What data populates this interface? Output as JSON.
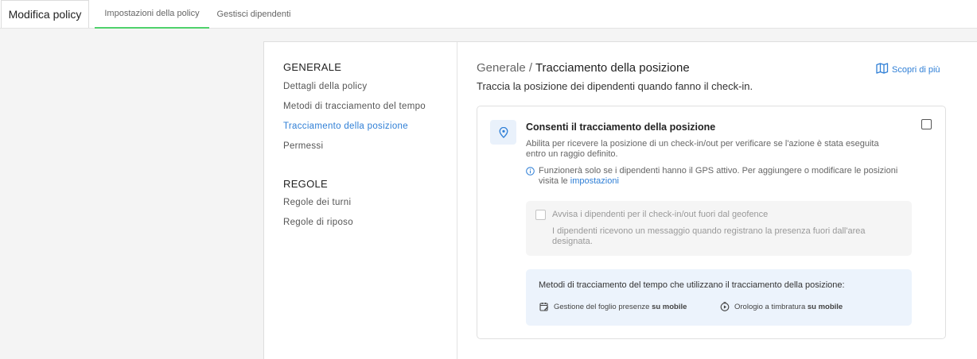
{
  "header": {
    "title": "Modifica policy",
    "tabs": [
      {
        "label": "Impostazioni della policy",
        "active": true
      },
      {
        "label": "Gestisci dipendenti",
        "active": false
      }
    ]
  },
  "sidebar": {
    "sections": [
      {
        "title": "GENERALE",
        "items": [
          "Dettagli della policy",
          "Metodi di tracciamento del tempo",
          "Tracciamento della posizione",
          "Permessi"
        ]
      },
      {
        "title": "REGOLE",
        "items": [
          "Regole dei turni",
          "Regole di riposo"
        ]
      }
    ],
    "active_item": "Tracciamento della posizione"
  },
  "main": {
    "breadcrumb_parent": "Generale /",
    "breadcrumb_current": "Tracciamento della posizione",
    "subtitle": "Traccia la posizione dei dipendenti quando fanno il check-in.",
    "learn_more": "Scopri di più",
    "option": {
      "title": "Consenti il tracciamento della posizione",
      "description": "Abilita per ricevere la posizione di un check-in/out per verificare se l'azione è stata eseguita entro un raggio definito.",
      "info": "Funzionerà solo se i dipendenti hanno il GPS attivo. Per aggiungere o modificare le posizioni visita le",
      "info_link": "impostazioni",
      "checked": false
    },
    "geofence": {
      "title": "Avvisa i dipendenti per il check-in/out fuori dal geofence",
      "description": "I dipendenti ricevono un messaggio quando registrano la presenza fuori dall'area designata.",
      "checked": false
    },
    "methods": {
      "title": "Metodi di tracciamento del tempo che utilizzano il tracciamento della posizione:",
      "items": [
        {
          "label": "Gestione del foglio presenze",
          "suffix": "su mobile",
          "icon": "calendar-edit-icon"
        },
        {
          "label": "Orologio a timbratura",
          "suffix": "su mobile",
          "icon": "clock-play-icon"
        }
      ]
    }
  },
  "colors": {
    "accent": "#2f7fd6",
    "active_tab": "#4fd16b",
    "methods_bg": "#ecf3fc",
    "geofence_bg": "#f5f5f5"
  }
}
